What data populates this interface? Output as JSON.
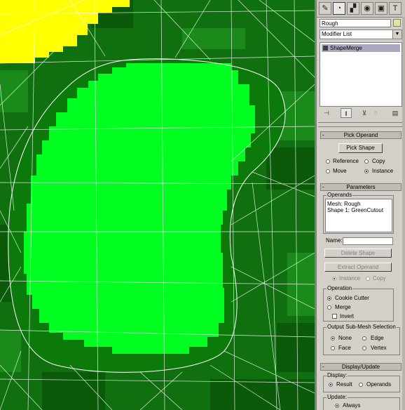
{
  "viewport": {
    "colors": {
      "terrain": "#107010",
      "terrain_light": "#1a8a1a",
      "terrain_dark": "#0a5a0a",
      "outer_ring": "#0b7a0b",
      "green_cutout": "#00ff20",
      "yellow_patch": "#ffff00",
      "wireframe": "#ffffff"
    }
  },
  "command_panel": {
    "tabs": [
      {
        "name": "create-tab-icon",
        "glyph": "✎"
      },
      {
        "name": "modify-tab-icon",
        "glyph": "◔"
      },
      {
        "name": "hierarchy-tab-icon",
        "glyph": "▞"
      },
      {
        "name": "motion-tab-icon",
        "glyph": "◉"
      },
      {
        "name": "display-tab-icon",
        "glyph": "▣"
      },
      {
        "name": "utilities-tab-icon",
        "glyph": "T"
      }
    ],
    "object_name": "Rough",
    "object_color": "#d8e8a0",
    "modifier_list_label": "Modifier List",
    "stack_items": [
      "ShapeMerge"
    ],
    "stack_tools": [
      "⊣",
      "‖",
      "⊻",
      "◌",
      "▤"
    ]
  },
  "pick_operand": {
    "title": "Pick Operand",
    "button": "Pick Shape",
    "options": {
      "reference": "Reference",
      "copy": "Copy",
      "move": "Move",
      "instance": "Instance"
    },
    "selected": "Instance"
  },
  "parameters": {
    "title": "Parameters",
    "operands_group": "Operands",
    "operands": [
      "Mesh: Rough",
      "Shape 1: GreenCutout"
    ],
    "name_label": "Name:",
    "name_value": "",
    "delete_shape": "Delete Shape",
    "extract_operand": "Extract Operand",
    "extract_instance": "Instance",
    "extract_copy": "Copy",
    "operation_group": "Operation",
    "cookie_cutter": "Cookie Cutter",
    "merge": "Merge",
    "invert": "Invert",
    "operation_selected": "Cookie Cutter",
    "invert_checked": false,
    "submesh_group": "Output Sub-Mesh Selection",
    "submesh": {
      "none": "None",
      "edge": "Edge",
      "face": "Face",
      "vertex": "Vertex"
    },
    "submesh_selected": "None"
  },
  "display_update": {
    "title": "Display/Update",
    "display_group": "Display:",
    "result": "Result",
    "operands": "Operands",
    "display_selected": "Result",
    "update_group": "Update:",
    "always": "Always"
  }
}
